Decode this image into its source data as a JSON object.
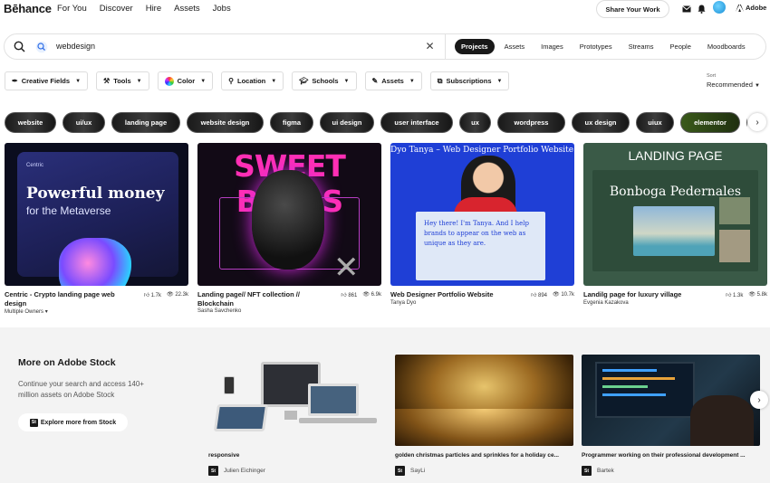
{
  "header": {
    "logo": "Bēhance",
    "nav": [
      "For You",
      "Discover",
      "Hire",
      "Assets",
      "Jobs"
    ],
    "share_label": "Share Your Work",
    "adobe_label": "Adobe"
  },
  "search": {
    "query": "webdesign",
    "tabs": [
      "Projects",
      "Assets",
      "Images",
      "Prototypes",
      "Streams",
      "People",
      "Moodboards"
    ],
    "active_tab": "Projects"
  },
  "filters": {
    "items": [
      {
        "label": "Creative Fields",
        "icon": "pen-tool-icon"
      },
      {
        "label": "Tools",
        "icon": "tools-icon"
      },
      {
        "label": "Color",
        "icon": "color-wheel-icon"
      },
      {
        "label": "Location",
        "icon": "location-pin-icon"
      },
      {
        "label": "Schools",
        "icon": "graduation-cap-icon"
      },
      {
        "label": "Assets",
        "icon": "assets-icon"
      },
      {
        "label": "Subscriptions",
        "icon": "subscriptions-icon"
      }
    ],
    "sort_label": "Sort",
    "sort_value": "Recommended"
  },
  "tags": [
    "website",
    "ui/ux",
    "landing page",
    "website design",
    "figma",
    "ui design",
    "user interface",
    "ux",
    "wordpress",
    "ux design",
    "uiux",
    "elementor"
  ],
  "projects": [
    {
      "title": "Centric - Crypto landing page web design",
      "owner": "Multiple Owners",
      "likes": "1.7k",
      "views": "22.3k",
      "thumb_headline": "Powerful money",
      "thumb_sub": "for the Metaverse",
      "thumb_brand": "Centric"
    },
    {
      "title": "Landing page// NFT collection // Blockchain",
      "owner": "Sasha Savchenko",
      "likes": "861",
      "views": "6.9k",
      "thumb_headline": "SWEET BEARS"
    },
    {
      "title": "Web Designer Portfolio Website",
      "owner": "Tanya Dyo",
      "likes": "894",
      "views": "10.7k",
      "thumb_headline": "Dyo Tanya – Web Designer Portfolio Website",
      "thumb_note": "Hey there! I'm Tanya. And I help brands to appear on the web as unique as they are."
    },
    {
      "title": "Landilg page for luxury village",
      "owner": "Evgenia Kazakova",
      "likes": "1.3k",
      "views": "5.8k",
      "thumb_headline": "LANDING PAGE",
      "thumb_sub": "Bonboga Pedernales"
    }
  ],
  "stock": {
    "title": "More on Adobe Stock",
    "description": "Continue your search and access 140+ million assets on Adobe Stock",
    "button_label": "Explore more from Stock",
    "badge": "St",
    "items": [
      {
        "title": "responsive",
        "author": "Julien Eichinger"
      },
      {
        "title": "golden christmas particles and sprinkles for a holiday ce...",
        "author": "SayLi"
      },
      {
        "title": "Programmer working on their professional development ...",
        "author": "Bartek"
      }
    ]
  }
}
